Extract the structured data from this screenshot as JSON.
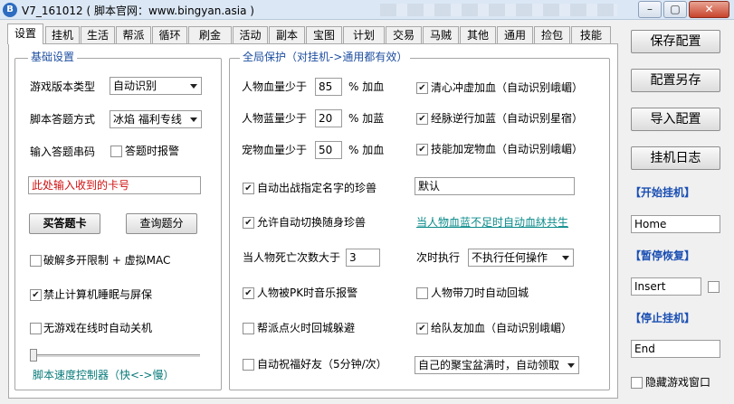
{
  "window": {
    "title": "V7_161012 ( 脚本官网：www.bingyan.asia )",
    "btn_minimize": "–",
    "btn_restore": "▢",
    "btn_close": "✕"
  },
  "tabs": [
    "设置",
    "挂机",
    "生活",
    "帮派",
    "循环",
    "刷金",
    "活动",
    "副本",
    "宝图",
    "计划",
    "交易",
    "马贼",
    "其他",
    "通用",
    "捡包",
    "技能"
  ],
  "basic": {
    "legend": "基础设置",
    "version_label": "游戏版本类型",
    "version_value": "自动识别",
    "answer_label": "脚本答题方式",
    "answer_value": "冰焰 福利专线",
    "code_label": "输入答题串码",
    "alarm_label": "答题时报警",
    "card_placeholder": "此处输入收到的卡号",
    "buy_button": "买答题卡",
    "query_button": "查询题分",
    "multi_label": "破解多开限制 + 虚拟MAC",
    "sleep_label": "禁止计算机睡眠与屏保",
    "shutdown_label": "无游戏在线时自动关机",
    "speed_label": "脚本速度控制器（快<->慢）"
  },
  "global": {
    "legend": "全局保护（对挂机->通用都有效）",
    "hp_label": "人物血量少于",
    "hp_value": "85",
    "hp_unit": "% 加血",
    "mp_label": "人物蓝量少于",
    "mp_value": "20",
    "mp_unit": "% 加蓝",
    "pet_label": "宠物血量少于",
    "pet_value": "50",
    "pet_unit": "% 加血",
    "heal_label": "清心冲虚加血（自动识别峨嵋）",
    "mana_label": "经脉逆行加蓝（自动识别星宿）",
    "petheal_label": "技能加宠物血（自动识别峨嵋）",
    "summon_label": "自动出战指定名字的珍兽",
    "summon_value": "默认",
    "switch_label": "允许自动切换随身珍兽",
    "link_label": "当人物血蓝不足时自动血䊾共生",
    "death_label": "当人物死亡次数大于",
    "death_value": "3",
    "exec_label": "次时执行",
    "exec_value": "不执行任何操作",
    "pk_label": "人物被PK时音乐报警",
    "carry_label": "人物带刀时自动回城",
    "fire_label": "帮派点火时回城躲避",
    "party_label": "给队友加血（自动识别峨嵋）",
    "bless_label": "自动祝福好友（5分钟/次）",
    "treasure_value": "自己的聚宝盆满时，自动领取"
  },
  "right": {
    "save_button": "保存配置",
    "saveas_button": "配置另存",
    "import_button": "导入配置",
    "log_button": "挂机日志",
    "start_label": "【开始挂机】",
    "start_key": "Home",
    "pause_label": "【暂停恢复】",
    "pause_key": "Insert",
    "stop_label": "【停止挂机】",
    "stop_key": "End",
    "hide_label": "隐藏游戏窗口"
  }
}
